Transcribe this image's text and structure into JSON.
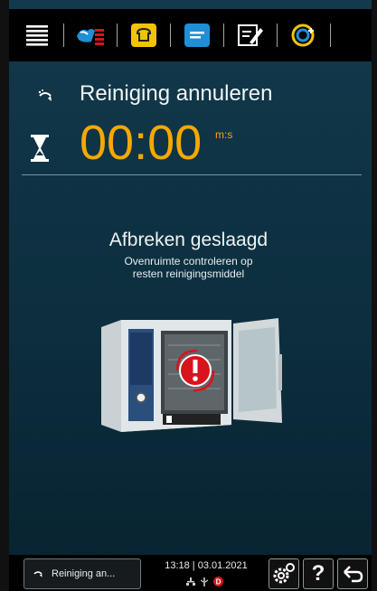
{
  "toolbar": {
    "items": [
      {
        "icon": "menu-icon"
      },
      {
        "icon": "intelligent-cooking-icon"
      },
      {
        "icon": "bread-baking-icon"
      },
      {
        "icon": "program-list-icon"
      },
      {
        "icon": "edit-program-icon"
      },
      {
        "icon": "cleaning-icon"
      }
    ]
  },
  "status": {
    "program_name": "Reiniging annuleren",
    "timer": "00:00",
    "timer_unit": "m:s"
  },
  "message": {
    "title": "Afbreken geslaagd",
    "subtitle": "Ovenruimte controleren op\nresten reinigingsmiddel"
  },
  "bottombar": {
    "program_button_label": "Reiniging an...",
    "time": "13:18",
    "date": "03.01.2021",
    "settings_icon": "settings-icon",
    "help_label": "?",
    "back_icon": "back-arrow-icon"
  },
  "colors": {
    "accent": "#f6a800",
    "background": "#0f3446",
    "topbar_blue": "#1f8fd6",
    "topbar_yellow": "#f2c400",
    "alert_red": "#d7141c"
  }
}
